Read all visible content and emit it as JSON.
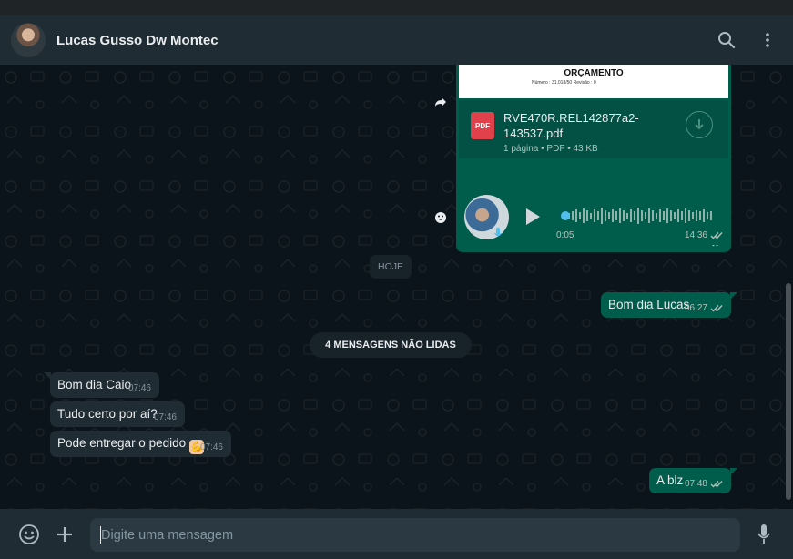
{
  "header": {
    "contact_name": "Lucas Gusso Dw Montec"
  },
  "document_message": {
    "preview_title": "ORÇAMENTO",
    "preview_line": "Número :        31.018/50                   Revisão :      0",
    "file_name": "RVE470R.REL142877a2-143537.pdf",
    "file_info": "1 página • PDF • 43 KB",
    "pdf_badge": "PDF",
    "time": "14:36"
  },
  "audio_message": {
    "duration": "0:05",
    "time": "14:36"
  },
  "date_chip": "HOJE",
  "unread_chip": "4 MENSAGENS NÃO LIDAS",
  "messages_out": [
    {
      "text": "Bom dia Lucas",
      "time": "06:27"
    },
    {
      "text": "A blz",
      "time": "07:48"
    }
  ],
  "messages_in": [
    {
      "text": "Bom dia Caio",
      "time": "07:46"
    },
    {
      "text": "Tudo certo por aí?",
      "time": "07:46"
    },
    {
      "text": "Pode entregar o pedido",
      "time": "07:46",
      "emoji": "💪"
    }
  ],
  "composer": {
    "placeholder": "Digite uma mensagem"
  },
  "icons": [
    "search-icon",
    "menu-icon",
    "forward-icon",
    "download-icon",
    "play-icon",
    "emoji-icon",
    "plus-icon",
    "mic-icon",
    "double-check-icon"
  ],
  "colors": {
    "outgoing_bubble": "#005c4b",
    "incoming_bubble": "#202c33",
    "header": "#202c33",
    "background": "#0b141a",
    "audio_dot": "#53bdeb"
  }
}
